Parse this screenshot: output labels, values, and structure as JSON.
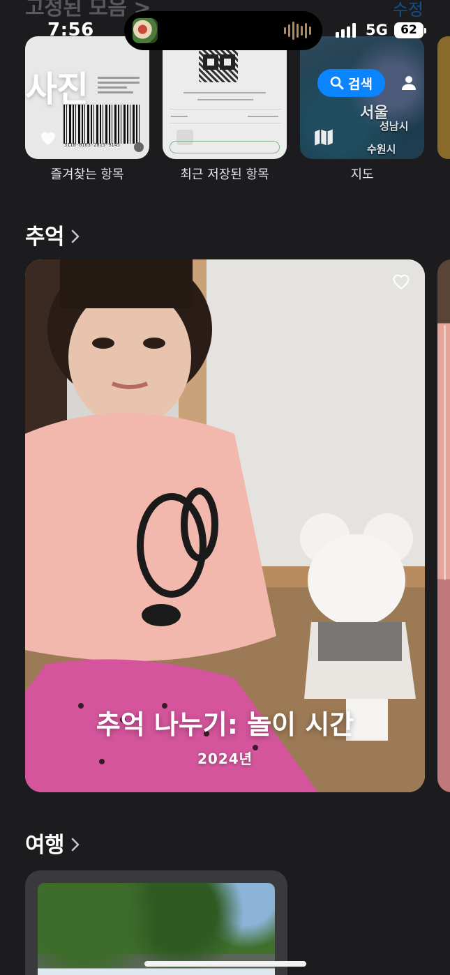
{
  "status_bar": {
    "time": "7:56",
    "network": "5G",
    "battery": "62"
  },
  "pinned": {
    "title": "고정된 모음 >",
    "edit_label": "수정",
    "tiles": [
      {
        "label": "즐겨찾는 항목",
        "ticket_number": "3110-0163-2815-9145"
      },
      {
        "label": "최근 저장된 항목"
      },
      {
        "label": "지도",
        "map_labels": [
          "서울",
          "성남시",
          "수원시"
        ]
      }
    ]
  },
  "header": {
    "title": "사진",
    "search_label": "검색"
  },
  "memories": {
    "section_title": "추억",
    "card_title": "추억 나누기: 놀이 시간",
    "card_subtitle": "2024년"
  },
  "trips": {
    "section_title": "여행"
  },
  "colors": {
    "background": "#1c1c1e",
    "accent": "#0a84ff"
  }
}
